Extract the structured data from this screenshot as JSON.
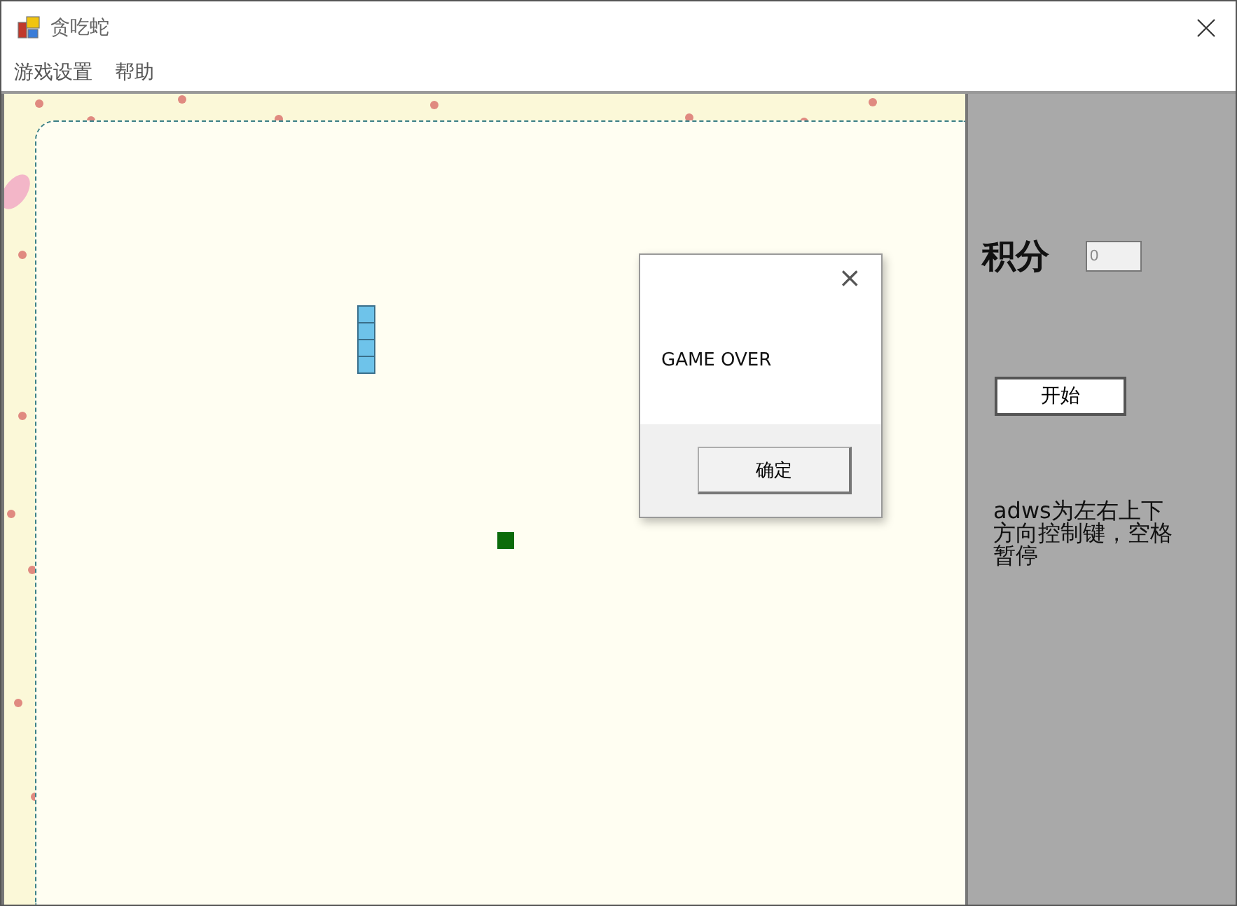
{
  "window": {
    "title": "贪吃蛇"
  },
  "menu": [
    {
      "label": "游戏设置"
    },
    {
      "label": "帮助"
    }
  ],
  "side_panel": {
    "score_label": "积分",
    "score_value": "0",
    "start_button": "开始",
    "help_text": "adws为左右上下方向控制键，空格暂停"
  },
  "dialog": {
    "message": "GAME OVER",
    "button": "确定",
    "close": "×"
  }
}
